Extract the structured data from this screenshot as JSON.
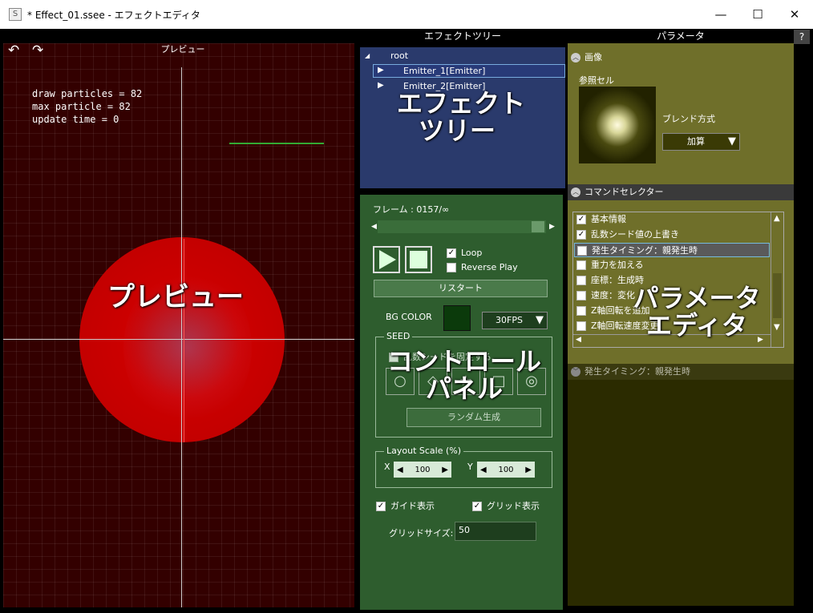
{
  "window": {
    "title": "* Effect_01.ssee - エフェクトエディタ",
    "app_icon": "S",
    "minimize": "—",
    "maximize": "☐",
    "close": "✕"
  },
  "headers": {
    "effect_tree": "エフェクトツリー",
    "parameters": "パラメータ",
    "help": "?"
  },
  "preview": {
    "title": "プレビュー",
    "undo": "↶",
    "redo": "↷",
    "stats": "draw particles = 82\nmax particle = 82\nupdate time = 0",
    "overlay_label": "プレビュー"
  },
  "tree": {
    "root": "root",
    "root_arrow": "◢",
    "items": [
      {
        "arrow": "▶",
        "label": "Emitter_1[Emitter]"
      },
      {
        "arrow": "▶",
        "label": "Emitter_2[Emitter]"
      }
    ],
    "overlay_label": "エフェクト\nツリー"
  },
  "control": {
    "frame": "フレーム : 0157/∞",
    "slider_left": "◀",
    "slider_right": "▶",
    "loop": "Loop",
    "reverse": "Reverse Play",
    "restart": "リスタート",
    "bg_color_label": "BG COLOR",
    "bg_color": "#0b3a0b",
    "fps": "30FPS",
    "fps_arrow": "▼",
    "seed_group": "SEED",
    "seed_fix": "乱数シードを固定する",
    "seed_shapes": [
      "○",
      "◇",
      "☆",
      "□",
      "◎"
    ],
    "random_gen": "ランダム生成",
    "layout_group": "Layout Scale (%)",
    "x_label": "X",
    "y_label": "Y",
    "x_value": "100",
    "y_value": "100",
    "spin_left": "◀",
    "spin_right": "▶",
    "guide": "ガイド表示",
    "grid": "グリッド表示",
    "grid_size_label": "グリッドサイズ:",
    "grid_size": "50",
    "overlay_label": "コントロール\nパネル",
    "checked": "✓"
  },
  "params": {
    "image_section": "画像",
    "ref_cell": "参照セル",
    "blend_label": "ブレンド方式",
    "blend_value": "加算",
    "blend_arrow": "▼",
    "cmd_section": "コマンドセレクター",
    "commands": [
      {
        "checked": true,
        "label": "基本情報"
      },
      {
        "checked": true,
        "label": "乱数シード値の上書き"
      },
      {
        "checked": false,
        "label": "発生タイミング：親発生時"
      },
      {
        "checked": false,
        "label": "重力を加える"
      },
      {
        "checked": false,
        "label": "座標：生成時"
      },
      {
        "checked": false,
        "label": "速度：変化"
      },
      {
        "checked": false,
        "label": "Z軸回転を追加"
      },
      {
        "checked": false,
        "label": "Z軸回転速度変更"
      }
    ],
    "scroll_up": "▲",
    "scroll_down": "▼",
    "scroll_left": "◀",
    "scroll_right": "▶",
    "timing_section": "発生タイミング：親発生時",
    "overlay_label": "パラメータ\nエディタ",
    "chev_up": "︿",
    "chev_down": "﹀"
  },
  "colors": {
    "preview_bg": "#300000",
    "tree_bg": "#2a3a6c",
    "control_bg": "#2e5d2e",
    "params_bg": "#6f6f2a"
  }
}
